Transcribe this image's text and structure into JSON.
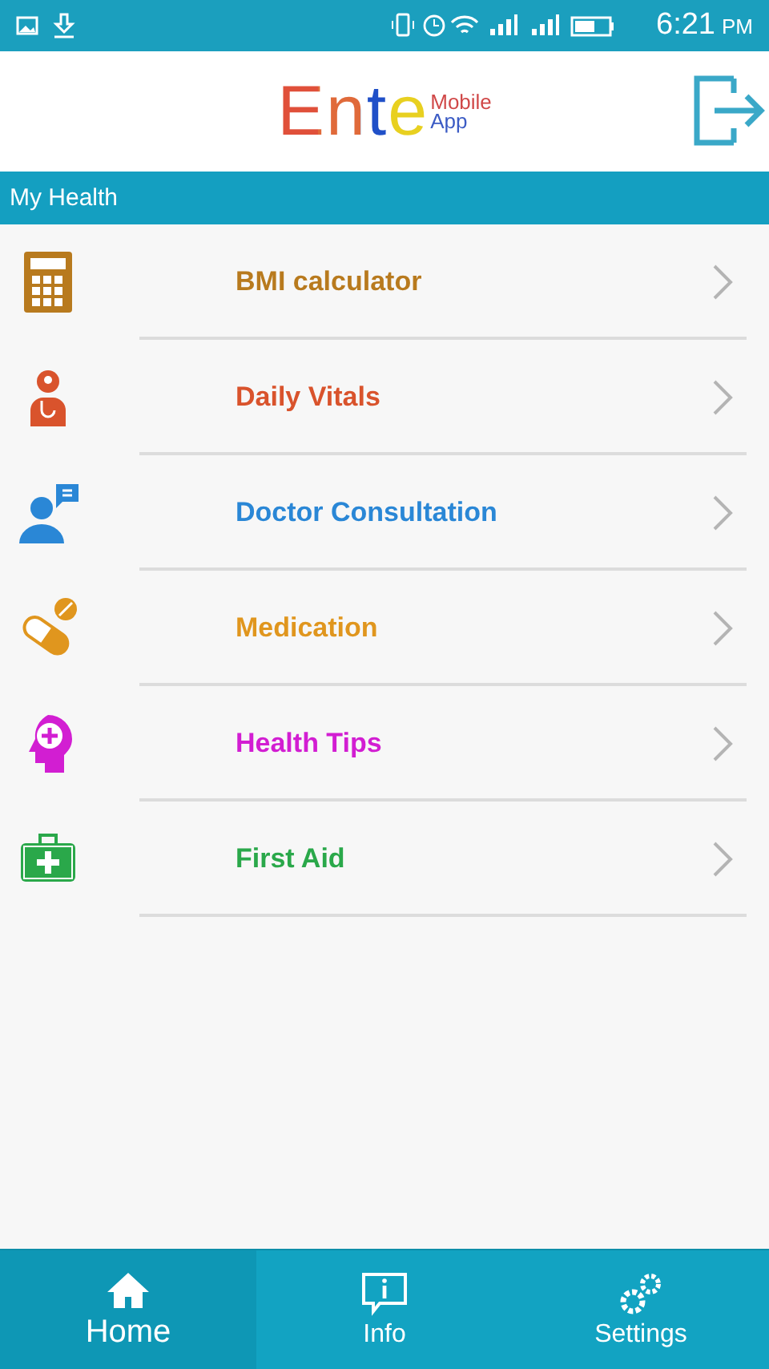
{
  "status_bar": {
    "time": "6:21",
    "period": "PM"
  },
  "header": {
    "logo": {
      "word": "Ente",
      "line_1": "Mobile",
      "line_2": "App"
    }
  },
  "section": {
    "title": "My Health"
  },
  "menu": [
    {
      "label": "BMI calculator",
      "kind": "calculator",
      "color": "#b87a1e"
    },
    {
      "label": "Daily Vitals",
      "kind": "vitals",
      "color": "#d9532c"
    },
    {
      "label": "Doctor Consultation",
      "kind": "consultation",
      "color": "#2a87d6"
    },
    {
      "label": "Medication",
      "kind": "pill",
      "color": "#e0961e"
    },
    {
      "label": "Health Tips",
      "kind": "tips",
      "color": "#d21ed2"
    },
    {
      "label": "First Aid",
      "kind": "firstaid",
      "color": "#2aa84a"
    }
  ],
  "bottom_nav": [
    {
      "label": "Home",
      "kind": "home",
      "selected": true
    },
    {
      "label": "Info",
      "kind": "info",
      "selected": false
    },
    {
      "label": "Settings",
      "kind": "settings",
      "selected": false
    }
  ]
}
